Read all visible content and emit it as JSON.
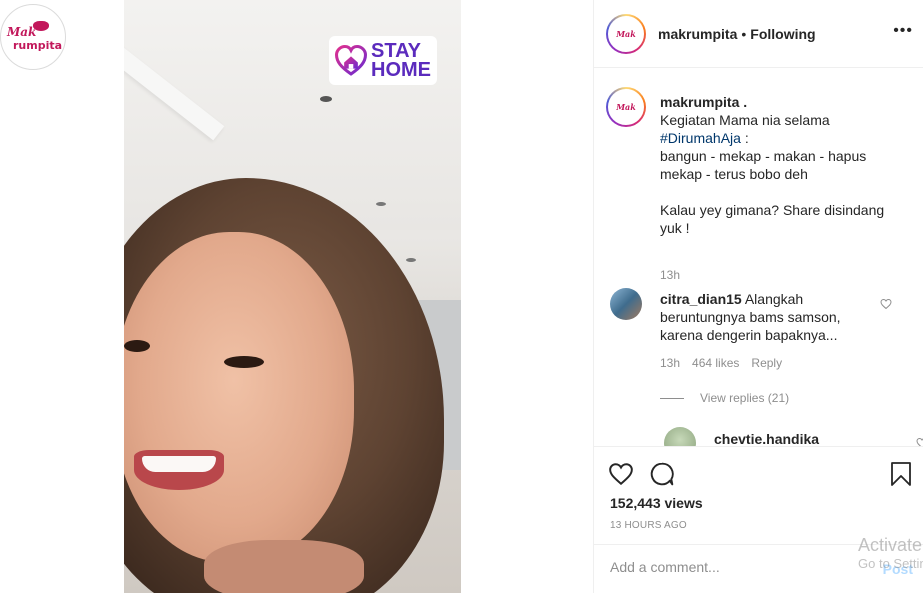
{
  "brand": {
    "logo_line1": "Mak",
    "logo_line2": "rumpita"
  },
  "video": {
    "sticker_line1": "STAY",
    "sticker_line2": "HOME"
  },
  "header": {
    "username": "makrumpita",
    "separator": "•",
    "follow_status": "Following",
    "more_icon": "more-horizontal-icon"
  },
  "caption": {
    "username": "makrumpita .",
    "line1": "Kegiatan Mama nia selama",
    "hashtag": "#DirumahAja",
    "after_hashtag": " :",
    "rest": "bangun - mekap - makan - hapus mekap - terus bobo deh\n\nKalau yey gimana? Share disindang yuk !",
    "time": "13h"
  },
  "comments": [
    {
      "username": "citra_dian15",
      "text": "Alangkah beruntungnya bams samson, karena dengerin bapaknya...",
      "time": "13h",
      "likes": "464 likes",
      "reply_label": "Reply",
      "view_replies": "View replies (21)"
    }
  ],
  "reply": {
    "username": "chevtie.handika"
  },
  "actions": {
    "views": "152,443 views",
    "time_ago": "13 HOURS AGO"
  },
  "add_comment": {
    "placeholder": "Add a comment...",
    "post_label": "Post"
  },
  "os_watermark": {
    "line1": "Activate",
    "line2": "Go to Settings"
  },
  "colors": {
    "brand": "#c2185b",
    "link": "#00376b",
    "secondary_text": "#8e8e8e",
    "post_button": "#b3dbff",
    "sticker": "#5b2bbd"
  }
}
